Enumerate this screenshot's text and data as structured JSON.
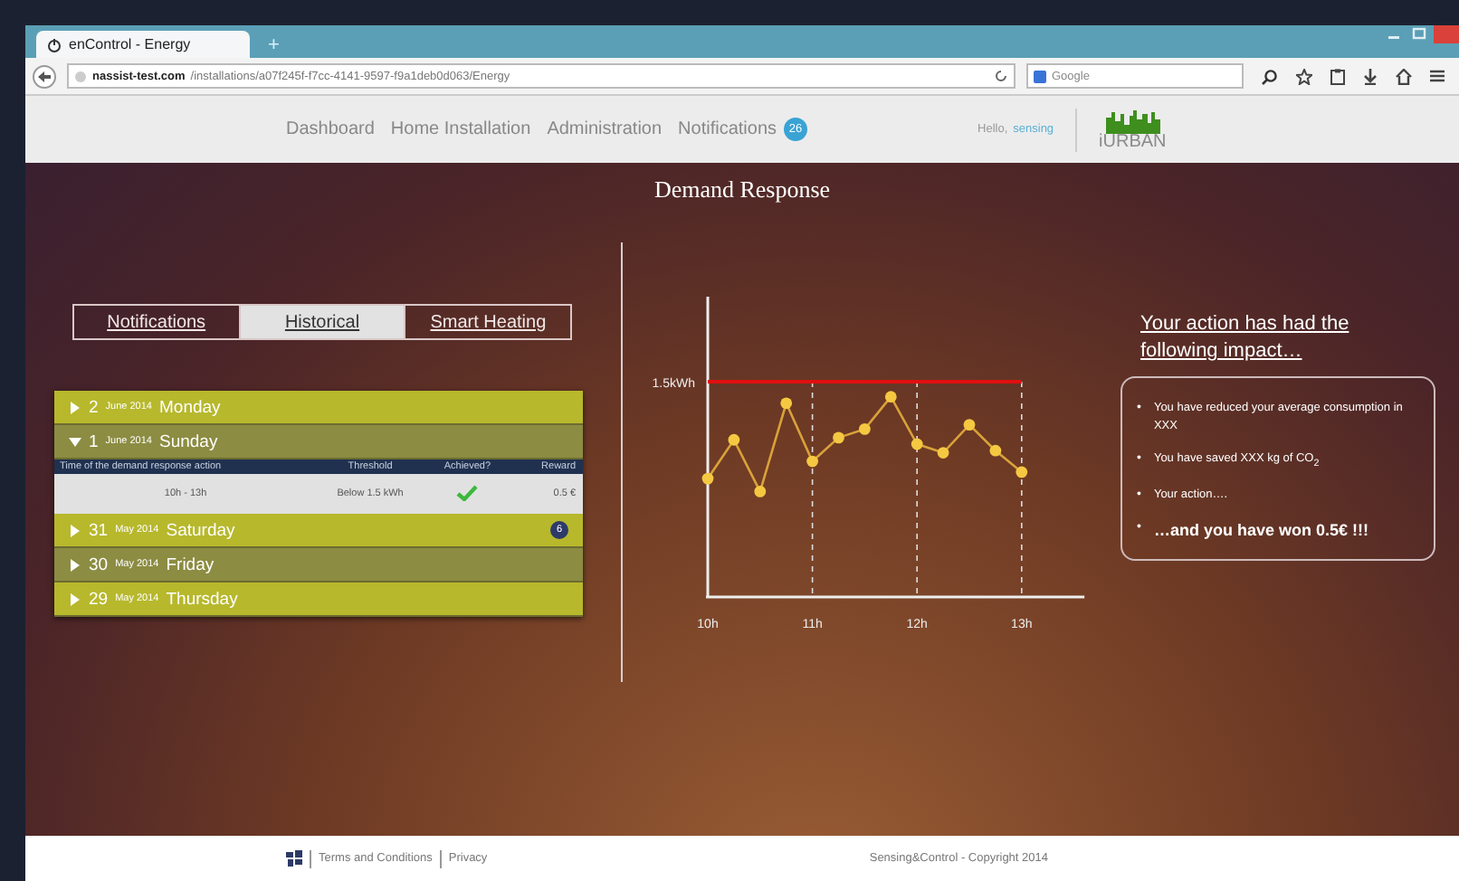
{
  "browser": {
    "tab_title": "enControl - Energy",
    "new_tab": "+",
    "url_host": "nassist-test.com",
    "url_path": "/installations/a07f245f-f7cc-4141-9597-f9a1deb0d063/Energy",
    "search_engine": "Google"
  },
  "nav": {
    "links": [
      {
        "label": "Dashboard"
      },
      {
        "label": "Home Installation"
      },
      {
        "label": "Administration"
      },
      {
        "label": "Notifications",
        "badge": "26"
      }
    ],
    "greeting": "Hello,",
    "user": "sensing",
    "logo": "iURBAN"
  },
  "page_title": "Demand Response",
  "tabs": [
    {
      "label": "Notifications",
      "selected": false
    },
    {
      "label": "Historical",
      "selected": true
    },
    {
      "label": "Smart Heating",
      "selected": false
    }
  ],
  "history": {
    "columns": [
      "Time of the demand response action",
      "Threshold",
      "Achieved?",
      "Reward"
    ],
    "days": [
      {
        "day": "2",
        "month": "June 2014",
        "weekday": "Monday",
        "expanded": false
      },
      {
        "day": "1",
        "month": "June 2014",
        "weekday": "Sunday",
        "expanded": true,
        "rows": [
          {
            "time": "10h - 13h",
            "threshold": "Below 1.5 kWh",
            "achieved": true,
            "reward": "0.5 €"
          }
        ]
      },
      {
        "day": "31",
        "month": "May 2014",
        "weekday": "Saturday",
        "expanded": false,
        "badge": "6"
      },
      {
        "day": "30",
        "month": "May 2014",
        "weekday": "Friday",
        "expanded": false
      },
      {
        "day": "29",
        "month": "May 2014",
        "weekday": "Thursday",
        "expanded": false
      }
    ]
  },
  "chart": {
    "threshold_label": "1.5kWh",
    "x_labels": [
      "10h",
      "11h",
      "12h",
      "13h"
    ]
  },
  "impact": {
    "heading": "Your action has had the following impact…",
    "items": [
      {
        "bullet": "•",
        "text": "You have reduced your average consumption in XXX",
        "kind": "normal"
      },
      {
        "bullet": "•",
        "text": "You have saved XXX kg of CO$_{2}$",
        "kind": "normal"
      },
      {
        "bullet": "•",
        "text": "Your action….",
        "kind": "normal"
      },
      {
        "bullet": "•",
        "text": "…and you have won 0.5€ !!!",
        "kind": "highlight"
      }
    ]
  },
  "footer": {
    "links": [
      "Terms and Conditions",
      "Privacy"
    ],
    "copyright": "Sensing&Control - Copyright 2014"
  }
}
